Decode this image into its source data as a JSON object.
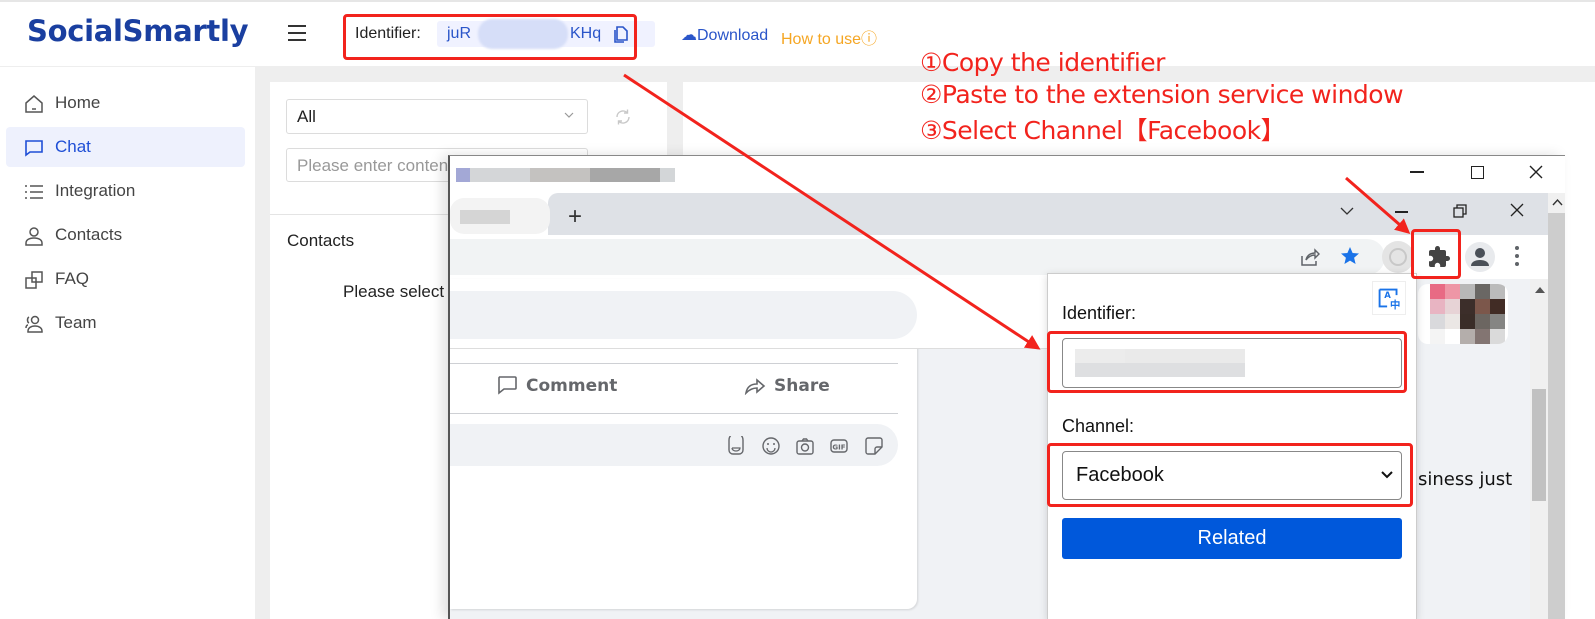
{
  "app": {
    "logo": "SocialSmartly",
    "identifier_label": "Identifier:",
    "identifier_value_start": "juR",
    "identifier_value_end": "KHq",
    "download_label": "☁Download",
    "how_to_use_label": "How to useⓘ"
  },
  "sidebar": {
    "items": [
      {
        "label": "Home",
        "icon": "home-icon",
        "active": false
      },
      {
        "label": "Chat",
        "icon": "chat-icon",
        "active": true
      },
      {
        "label": "Integration",
        "icon": "list-icon",
        "active": false
      },
      {
        "label": "Contacts",
        "icon": "user-icon",
        "active": false
      },
      {
        "label": "FAQ",
        "icon": "faq-icon",
        "active": false
      },
      {
        "label": "Team",
        "icon": "team-icon",
        "active": false
      }
    ]
  },
  "chat_panel": {
    "filter_value": "All",
    "search_placeholder": "Please enter content",
    "contacts_title": "Contacts",
    "select_hint": "Please select a"
  },
  "browser": {
    "new_tab": "+",
    "facebook": {
      "comment_label": "Comment",
      "share_label": "Share",
      "post_text_fragment": "siness just"
    },
    "extension_popup": {
      "identifier_label": "Identifier:",
      "identifier_value": "",
      "channel_label": "Channel:",
      "channel_value": "Facebook",
      "related_button": "Related"
    }
  },
  "annotations": {
    "steps": [
      "①Copy the identifier",
      "②Paste to the extension service window",
      "③Select Channel【Facebook】"
    ],
    "color": "#f2231d"
  },
  "colors": {
    "brand": "#1a3fa0",
    "link": "#2a55c9",
    "howto": "#f5a623",
    "active_nav_bg": "#eef1fd",
    "related_button": "#0058db"
  }
}
